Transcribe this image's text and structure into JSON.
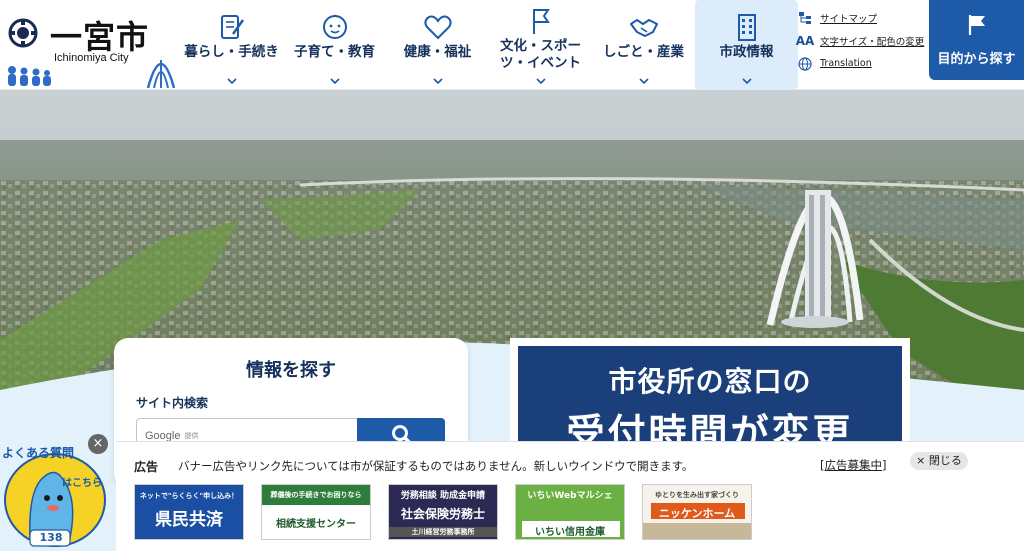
{
  "header": {
    "logo": {
      "title": "一宮市",
      "subtitle": "Ichinomiya City"
    },
    "nav": [
      {
        "label": "暮らし・手続き",
        "icon": "document-pen-icon"
      },
      {
        "label": "子育て・教育",
        "icon": "baby-face-icon"
      },
      {
        "label": "健康・福祉",
        "icon": "heart-icon"
      },
      {
        "label": "文化・スポーツ・イベント",
        "icon": "flag-icon"
      },
      {
        "label": "しごと・産業",
        "icon": "handshake-icon"
      },
      {
        "label": "市政情報",
        "icon": "building-icon"
      }
    ],
    "utility": [
      {
        "label": "サイトマップ",
        "icon": "sitemap-icon"
      },
      {
        "label": "文字サイズ・配色の変更",
        "icon": "font-size-icon",
        "glyph": "AA"
      },
      {
        "label": "Translation",
        "icon": "globe-icon"
      }
    ],
    "purpose_button": "目的から探す"
  },
  "search": {
    "title": "情報を探す",
    "label": "サイト内検索",
    "placeholder_brand": "Google",
    "placeholder_note": "提供"
  },
  "notice_banner": {
    "line1": "市役所の窓口の",
    "line2": "受付時間が変更"
  },
  "ads": {
    "label": "広告",
    "notice": "バナー広告やリンク先については市が保証するものではありません。新しいウインドウで開きます。",
    "recruit": "[広告募集中]",
    "close": "× 閉じる",
    "banners": [
      {
        "top": "ネットで\"らくらく\"申し込み！",
        "main": "県民共済"
      },
      {
        "top": "葬儀後の手続きでお困りなら",
        "main": "相続支援センター"
      },
      {
        "top": "労務相談 助成金申請",
        "main": "社会保険労務士",
        "sub": "土川経営労務事務所"
      },
      {
        "top": "いちいWebマルシェ",
        "main": "いちい信用金庫"
      },
      {
        "top": "ゆとりを生み出す家づくり",
        "main": "ニッケンホーム"
      }
    ]
  },
  "faq": {
    "line1": "よくある質問",
    "line2": "はこちら",
    "number": "138",
    "close": "×"
  },
  "colors": {
    "primary": "#1d5aa8",
    "navy": "#16325c",
    "active_nav": "#dcecfb",
    "banner_bg": "#1b3f7a"
  }
}
